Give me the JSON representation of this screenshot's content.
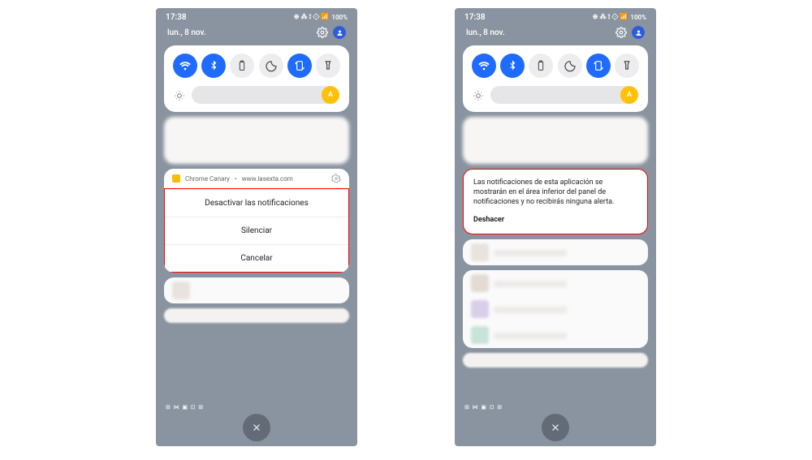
{
  "status": {
    "time": "17:38",
    "indicators": "⊕ ⁂ ⟟ ⟐ 📶",
    "battery": "100%"
  },
  "date": "lun., 8 nov.",
  "brightness_handle": "A",
  "leftPhone": {
    "menu": {
      "app_name": "Chrome Canary",
      "site": "www.lasexta.com",
      "items": [
        "Desactivar las notificaciones",
        "Silenciar",
        "Cancelar"
      ]
    }
  },
  "rightPhone": {
    "info_text": "Las notificaciones de esta aplicación se mostrarán en el área inferior del panel de notificaciones y no recibirás ninguna alerta.",
    "undo": "Deshacer"
  },
  "foot_icons": "⊞ ⋈ ▣ ⊡ ⊞"
}
